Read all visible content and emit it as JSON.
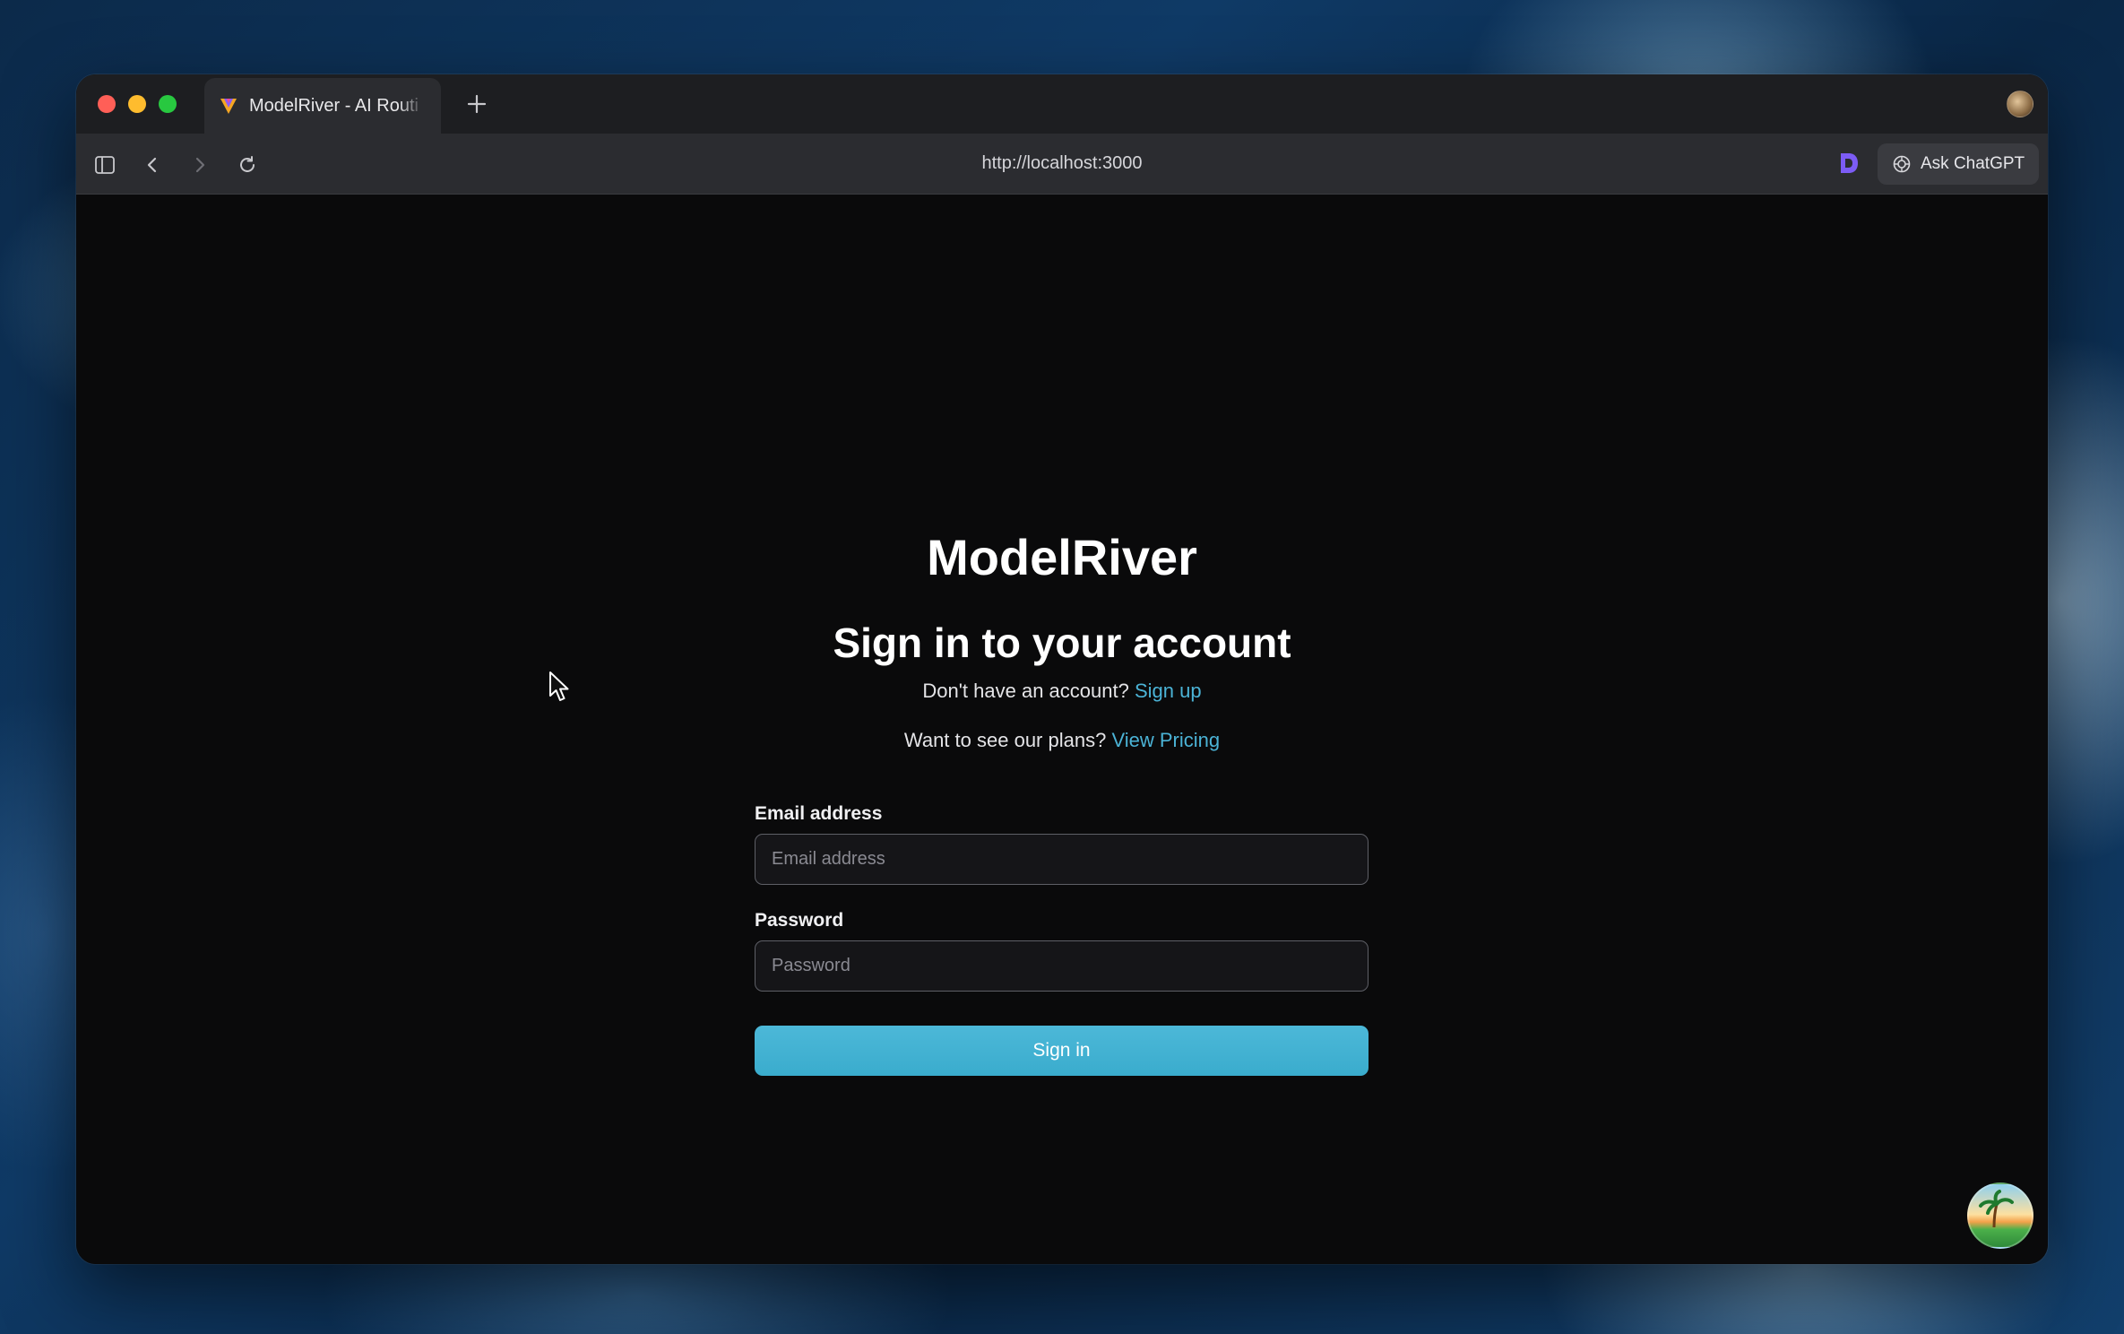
{
  "browser": {
    "tab_title": "ModelRiver - AI Routi",
    "new_tab_icon": "plus-icon",
    "url": "http://localhost:3000",
    "ask_chatgpt_label": "Ask ChatGPT"
  },
  "login": {
    "brand": "ModelRiver",
    "heading": "Sign in to your account",
    "signup_prompt": "Don't have an account?",
    "signup_link": "Sign up",
    "pricing_prompt": "Want to see our plans?",
    "pricing_link": "View Pricing",
    "email_label": "Email address",
    "email_placeholder": "Email address",
    "email_value": "",
    "password_label": "Password",
    "password_placeholder": "Password",
    "password_value": "",
    "submit_label": "Sign in"
  },
  "colors": {
    "accent": "#4bb3d6",
    "button": "#3fb0d0",
    "background": "#0a0a0b"
  }
}
